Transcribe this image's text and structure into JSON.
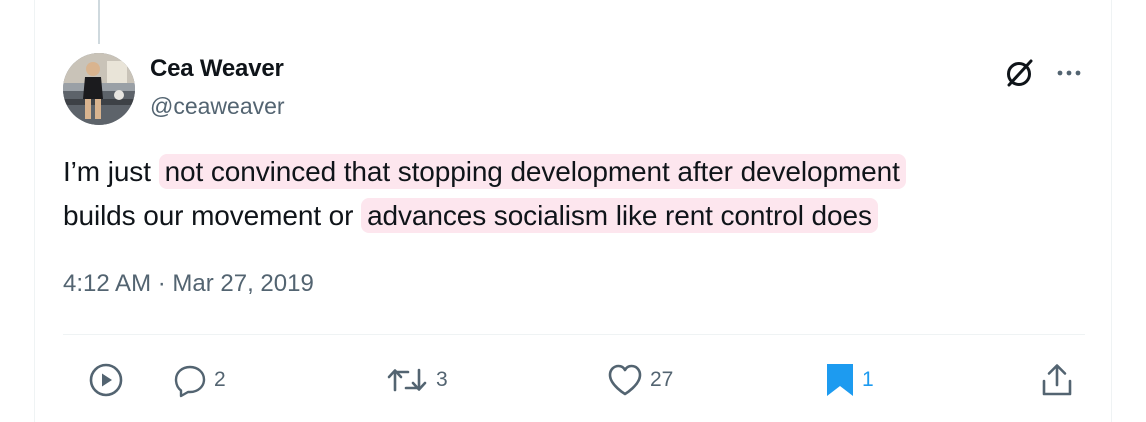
{
  "post": {
    "author_name": "Cea Weaver",
    "author_handle": "@ceaweaver",
    "text_parts": [
      "I’m just ",
      "not convinced that stopping development after development",
      "builds our movement or ",
      "advances socialism like rent control does"
    ],
    "timestamp": "4:12 AM · Mar 27, 2019"
  },
  "actions": {
    "replies": "2",
    "reposts": "3",
    "likes": "27",
    "bookmarks": "1"
  },
  "colors": {
    "highlight": "#fde6ee",
    "bookmark_active": "#1d9bf0",
    "secondary_text": "#536471"
  },
  "icons": [
    "grok-icon",
    "more-icon",
    "play-icon",
    "reply-icon",
    "repost-icon",
    "like-icon",
    "bookmark-icon",
    "share-icon"
  ]
}
